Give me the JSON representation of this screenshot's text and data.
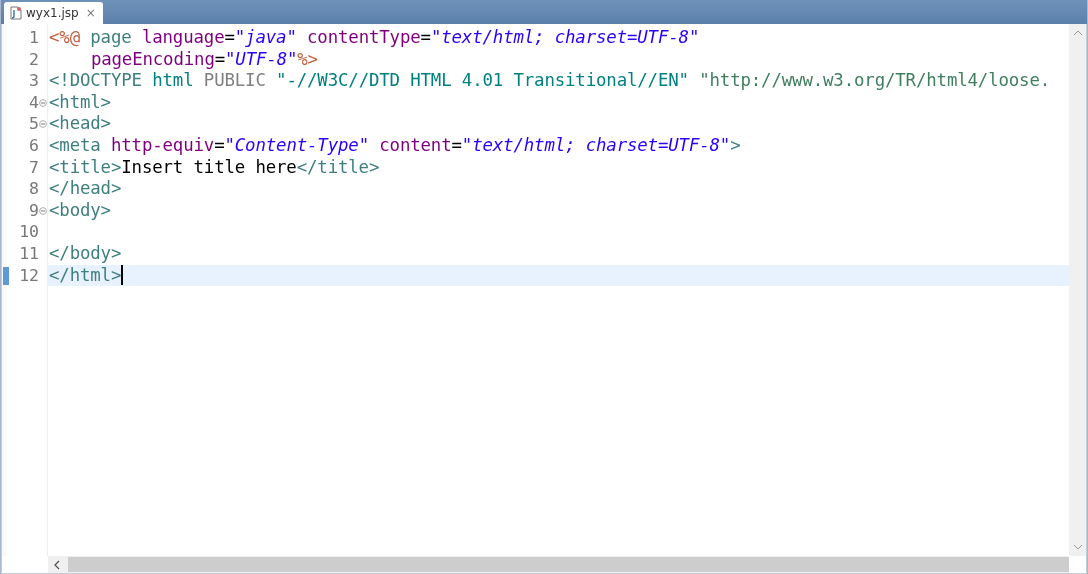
{
  "tab": {
    "title": "wyx1.jsp",
    "close": "×",
    "selected": true
  },
  "editor": {
    "lines": [
      {
        "number": "1",
        "foldable": false,
        "current": false,
        "tokens": [
          {
            "kind": "jsp",
            "text": "<%@"
          },
          {
            "kind": "directive",
            "text": " page"
          },
          {
            "kind": "attr",
            "text": " language"
          },
          {
            "kind": "text",
            "text": "="
          },
          {
            "kind": "str",
            "text": "\"java\""
          },
          {
            "kind": "attr",
            "text": " contentType"
          },
          {
            "kind": "text",
            "text": "="
          },
          {
            "kind": "str",
            "text": "\"text/html; charset=UTF-8\""
          }
        ]
      },
      {
        "number": "2",
        "foldable": false,
        "current": false,
        "indented": true,
        "tokens": [
          {
            "kind": "attr",
            "text": "pageEncoding"
          },
          {
            "kind": "text",
            "text": "="
          },
          {
            "kind": "str",
            "text": "\"UTF-8\""
          },
          {
            "kind": "jsp",
            "text": "%>"
          }
        ]
      },
      {
        "number": "3",
        "foldable": false,
        "current": false,
        "tokens": [
          {
            "kind": "tag",
            "text": "<!DOCTYPE"
          },
          {
            "kind": "doctype",
            "text": " html"
          },
          {
            "kind": "public",
            "text": " PUBLIC"
          },
          {
            "kind": "doctype",
            "text": " \"-//W3C//DTD HTML 4.01 Transitional//EN\""
          },
          {
            "kind": "url",
            "text": " \"http://www.w3.org/TR/html4/loose."
          }
        ]
      },
      {
        "number": "4",
        "foldable": true,
        "current": false,
        "tokens": [
          {
            "kind": "tag",
            "text": "<html>"
          }
        ]
      },
      {
        "number": "5",
        "foldable": true,
        "current": false,
        "tokens": [
          {
            "kind": "tag",
            "text": "<head>"
          }
        ]
      },
      {
        "number": "6",
        "foldable": false,
        "current": false,
        "tokens": [
          {
            "kind": "tag",
            "text": "<meta"
          },
          {
            "kind": "attr",
            "text": " http-equiv"
          },
          {
            "kind": "text",
            "text": "="
          },
          {
            "kind": "str",
            "text": "\"Content-Type\""
          },
          {
            "kind": "attr",
            "text": " content"
          },
          {
            "kind": "text",
            "text": "="
          },
          {
            "kind": "str",
            "text": "\"text/html; charset=UTF-8\""
          },
          {
            "kind": "tag",
            "text": ">"
          }
        ]
      },
      {
        "number": "7",
        "foldable": false,
        "current": false,
        "tokens": [
          {
            "kind": "tag",
            "text": "<title>"
          },
          {
            "kind": "text",
            "text": "Insert title here"
          },
          {
            "kind": "tag",
            "text": "</title>"
          }
        ]
      },
      {
        "number": "8",
        "foldable": false,
        "current": false,
        "tokens": [
          {
            "kind": "tag",
            "text": "</head>"
          }
        ]
      },
      {
        "number": "9",
        "foldable": true,
        "current": false,
        "tokens": [
          {
            "kind": "tag",
            "text": "<body>"
          }
        ]
      },
      {
        "number": "10",
        "foldable": false,
        "current": false
      },
      {
        "number": "11",
        "foldable": false,
        "current": false,
        "tokens": [
          {
            "kind": "tag",
            "text": "</body>"
          }
        ]
      },
      {
        "number": "12",
        "foldable": false,
        "current": true,
        "tokens": [
          {
            "kind": "tag",
            "text": "</html>"
          }
        ]
      }
    ]
  }
}
